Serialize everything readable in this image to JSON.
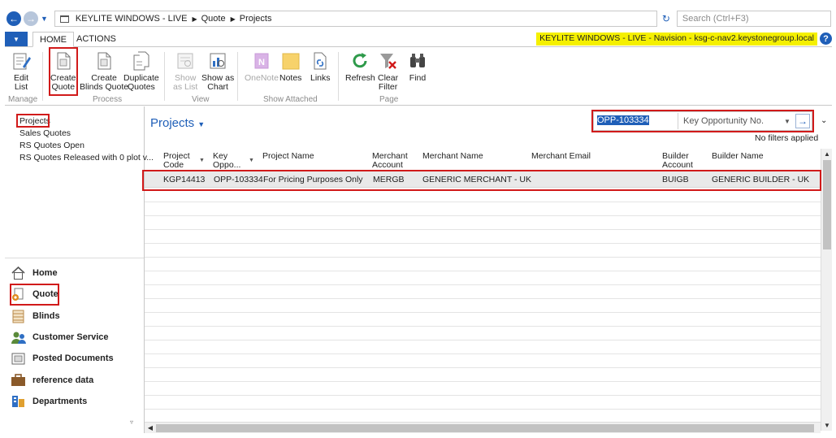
{
  "address": {
    "breadcrumb": [
      "KEYLITE WINDOWS - LIVE",
      "Quote",
      "Projects"
    ],
    "search_placeholder": "Search (Ctrl+F3)"
  },
  "ribbon_tabs": {
    "home": "HOME",
    "actions": "ACTIONS"
  },
  "environment_label": "KEYLITE WINDOWS - LIVE - Navision - ksg-c-nav2.keystonegroup.local",
  "ribbon": {
    "buttons": [
      {
        "line1": "Edit",
        "line2": "List"
      },
      {
        "line1": "Create",
        "line2": "Quote"
      },
      {
        "line1": "Create",
        "line2": "Blinds Quote"
      },
      {
        "line1": "Duplicate",
        "line2": "Quotes"
      },
      {
        "line1": "Show",
        "line2": "as List"
      },
      {
        "line1": "Show as",
        "line2": "Chart"
      },
      {
        "line1": "OneNote",
        "line2": ""
      },
      {
        "line1": "Notes",
        "line2": ""
      },
      {
        "line1": "Links",
        "line2": ""
      },
      {
        "line1": "Refresh",
        "line2": ""
      },
      {
        "line1": "Clear",
        "line2": "Filter"
      },
      {
        "line1": "Find",
        "line2": ""
      }
    ],
    "groups": [
      "Manage",
      "Process",
      "View",
      "Show Attached",
      "Page"
    ]
  },
  "left_nav": {
    "items": [
      "Projects",
      "Sales Quotes",
      "RS Quotes Open",
      "RS Quotes Released with 0 plot v..."
    ],
    "areas": [
      "Home",
      "Quote",
      "Blinds",
      "Customer Service",
      "Posted Documents",
      "reference data",
      "Departments"
    ]
  },
  "page": {
    "title": "Projects",
    "filter_value": "OPP-103334",
    "filter_field": "Key Opportunity No.",
    "no_filters": "No filters applied"
  },
  "table": {
    "columns": [
      {
        "l1": "Project",
        "l2": "Code"
      },
      {
        "l1": "Key",
        "l2": "Oppo..."
      },
      {
        "l1": "Project Name",
        "l2": ""
      },
      {
        "l1": "Merchant",
        "l2": "Account"
      },
      {
        "l1": "Merchant Name",
        "l2": ""
      },
      {
        "l1": "Merchant Email",
        "l2": ""
      },
      {
        "l1": "Builder",
        "l2": "Account"
      },
      {
        "l1": "Builder Name",
        "l2": ""
      }
    ],
    "rows": [
      [
        "KGP14413",
        "OPP-103334",
        "For Pricing Purposes Only",
        "MERGB",
        "GENERIC MERCHANT - UK",
        "",
        "BUIGB",
        "GENERIC BUILDER - UK"
      ]
    ]
  },
  "colors": {
    "accent": "#1f5fb8",
    "highlight": "#d11a1a",
    "env_badge": "#f5f000"
  }
}
